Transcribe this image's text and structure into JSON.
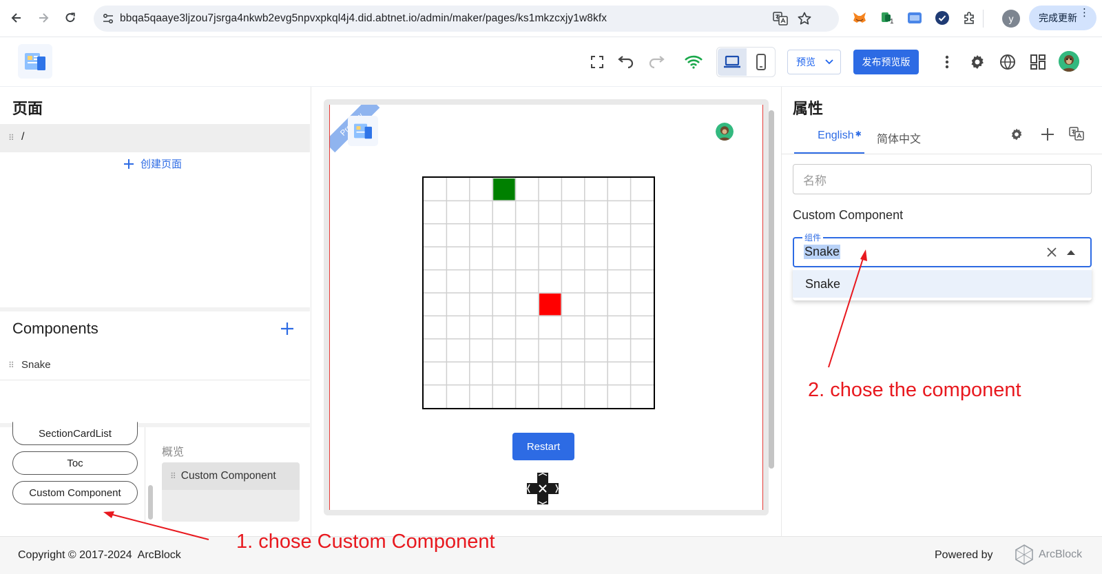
{
  "browser": {
    "url": "bbqa5qaaye3ljzou7jsrga4nkwb2evg5npvxpkql4j4.did.abtnet.io/admin/maker/pages/ks1mkzcxjy1w8kfx",
    "update_label": "完成更新",
    "profile_initial": "y",
    "ext_badge": "1"
  },
  "toolbar": {
    "preview_label": "预览",
    "publish_label": "发布预览版"
  },
  "pages_panel": {
    "title": "页面",
    "root_page": "/",
    "create_label": "创建页面"
  },
  "components_panel": {
    "title": "Components",
    "items": [
      "Snake"
    ]
  },
  "palette": {
    "items": [
      "SectionCardList",
      "Toc",
      "Custom Component"
    ],
    "overview_label": "概览",
    "card_label": "Custom Component"
  },
  "preview": {
    "ribbon": "Preview",
    "restart_label": "Restart",
    "grid": {
      "cols": 10,
      "rows": 10,
      "snake": [
        [
          3,
          0
        ]
      ],
      "food": [
        [
          5,
          5
        ]
      ],
      "snake_color": "#008000",
      "food_color": "#ff0000"
    }
  },
  "properties": {
    "title": "属性",
    "tabs": [
      "English",
      "简体中文"
    ],
    "name_placeholder": "名称",
    "section_label": "Custom Component",
    "component_field_label": "组件",
    "component_value": "Snake",
    "dropdown_options": [
      "Snake"
    ]
  },
  "footer": {
    "copyright": "Copyright © 2017-2024  ArcBlock",
    "powered_by": "Powered by",
    "brand": "ArcBlock"
  },
  "annotations": {
    "step1": "1. chose Custom Component",
    "step2": "2. chose the component"
  },
  "colors": {
    "accent": "#2d6be4",
    "annotation": "#e8181e"
  }
}
